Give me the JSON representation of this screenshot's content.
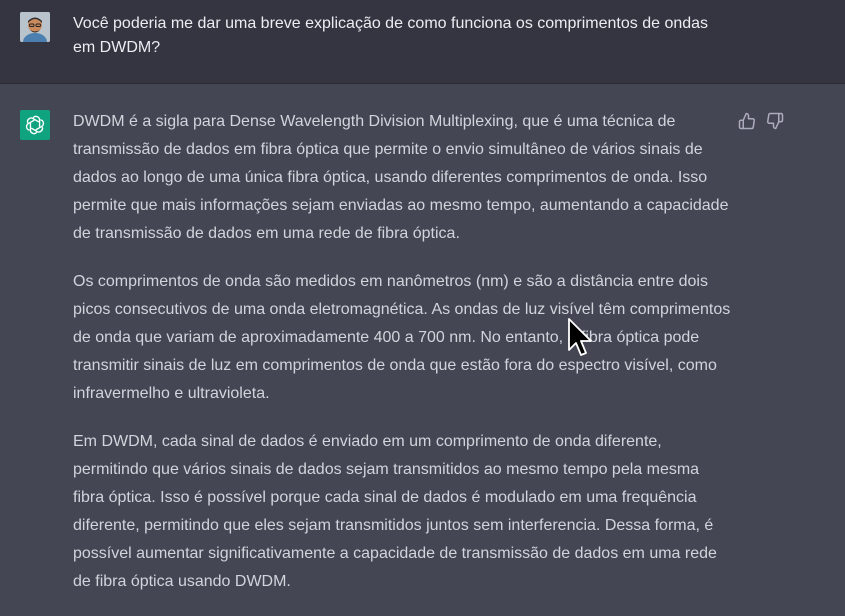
{
  "user": {
    "avatar_icon": "user-avatar",
    "message": "Você poderia me dar uma breve explicação de como funciona os comprimentos de ondas em DWDM?"
  },
  "assistant": {
    "avatar_icon": "chatgpt-logo-icon",
    "paragraphs": [
      "DWDM é a sigla para Dense Wavelength Division Multiplexing, que é uma técnica de transmissão de dados em fibra óptica que permite o envio simultâneo de vários sinais de dados ao longo de uma única fibra óptica, usando diferentes comprimentos de onda. Isso permite que mais informações sejam enviadas ao mesmo tempo, aumentando a capacidade de transmissão de dados em uma rede de fibra óptica.",
      "Os comprimentos de onda são medidos em nanômetros (nm) e são a distância entre dois picos consecutivos de uma onda eletromagnética. As ondas de luz visível têm comprimentos de onda que variam de aproximadamente 400 a 700 nm. No entanto, a fibra óptica pode transmitir sinais de luz em comprimentos de onda que estão fora do espectro visível, como infravermelho e ultravioleta.",
      "Em DWDM, cada sinal de dados é enviado em um comprimento de onda diferente, permitindo que vários sinais de dados sejam transmitidos ao mesmo tempo pela mesma fibra óptica. Isso é possível porque cada sinal de dados é modulado em uma frequência diferente, permitindo que eles sejam transmitidos juntos sem interferencia. Dessa forma, é possível aumentar significativamente a capacidade de transmissão de dados em uma rede de fibra óptica usando DWDM."
    ],
    "feedback": {
      "up_icon": "thumbs-up-icon",
      "down_icon": "thumbs-down-icon"
    }
  },
  "colors": {
    "user_bg": "#343541",
    "assistant_bg": "#444654",
    "brand": "#10a37f"
  }
}
